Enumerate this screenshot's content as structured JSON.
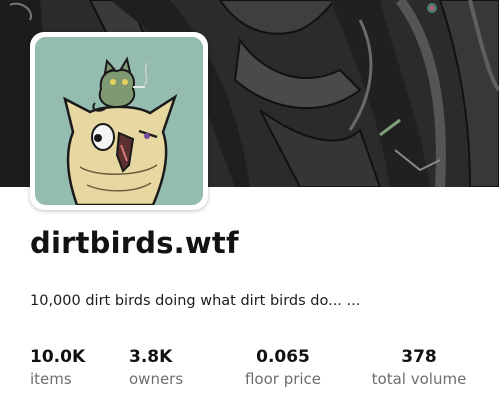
{
  "collection": {
    "name": "dirtbirds.wtf",
    "description": "10,000 dirt birds doing what dirt birds do... ..."
  },
  "banner": {
    "image": "dark-forest-art"
  },
  "avatar": {
    "image": "dirt-bird-with-cat-art"
  },
  "stats": [
    {
      "value": "10.0K",
      "label": "items"
    },
    {
      "value": "3.8K",
      "label": "owners"
    },
    {
      "value": "0.065",
      "label": "floor price"
    },
    {
      "value": "378",
      "label": "total volume"
    }
  ],
  "colors": {
    "avatar_bg": "#95bcb0",
    "bird_body": "#e6d8a0",
    "cat": "#7f9a73",
    "banner_dark": "#262626",
    "label_grey": "#6e6e6e"
  }
}
